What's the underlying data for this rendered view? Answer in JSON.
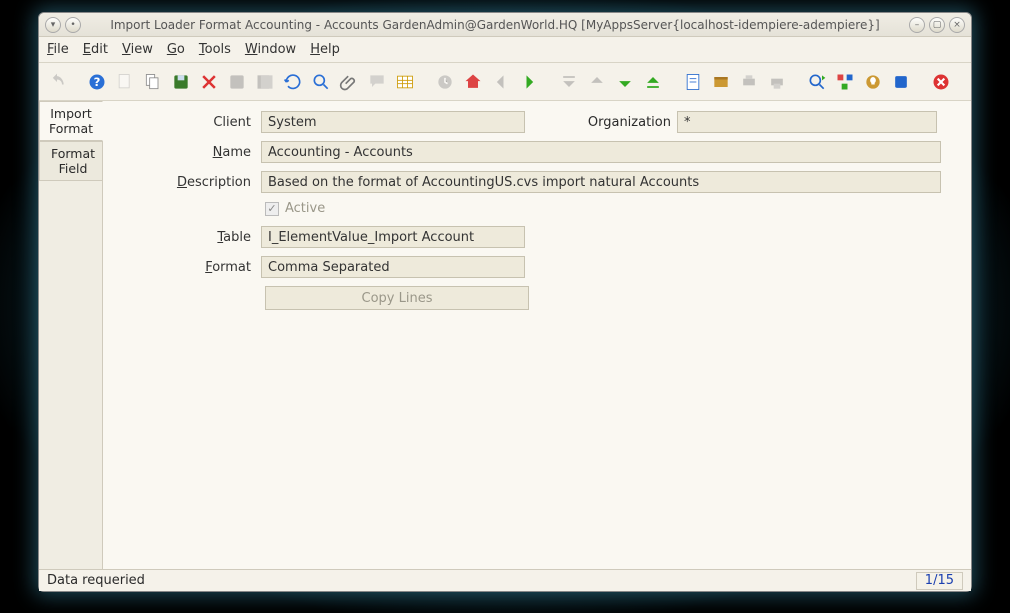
{
  "window": {
    "title": "Import Loader Format  Accounting - Accounts  GardenAdmin@GardenWorld.HQ [MyAppsServer{localhost-idempiere-adempiere}]"
  },
  "menu": {
    "file": "File",
    "edit": "Edit",
    "view": "View",
    "go": "Go",
    "tools": "Tools",
    "window": "Window",
    "help": "Help"
  },
  "toolbar_icons": [
    "undo",
    "help",
    "new",
    "copy",
    "save",
    "delete",
    "delete-selection",
    "save-changes",
    "refresh-all",
    "refresh",
    "find",
    "attachment",
    "chat",
    "grid",
    "history",
    "home",
    "back",
    "forward",
    "parent-first",
    "parent-up",
    "detail-down",
    "detail-last",
    "report",
    "archive",
    "print-preview",
    "print",
    "zoom-across",
    "workflow",
    "requests",
    "product-info",
    "close"
  ],
  "tabs": {
    "import_format": "Import Format",
    "format_field": "Format Field"
  },
  "form": {
    "client_label": "Client",
    "client_value": "System",
    "org_label": "Organization",
    "org_value": "*",
    "name_label": "Name",
    "name_value": "Accounting - Accounts",
    "desc_label": "Description",
    "desc_value": "Based on the format of AccountingUS.cvs import natural Accounts",
    "active_label": "Active",
    "active_checked": true,
    "table_label": "Table",
    "table_value": "I_ElementValue_Import Account",
    "format_label": "Format",
    "format_value": "Comma Separated",
    "copy_label": "Copy Lines"
  },
  "status": {
    "message": "Data requeried",
    "position": "1/15"
  }
}
